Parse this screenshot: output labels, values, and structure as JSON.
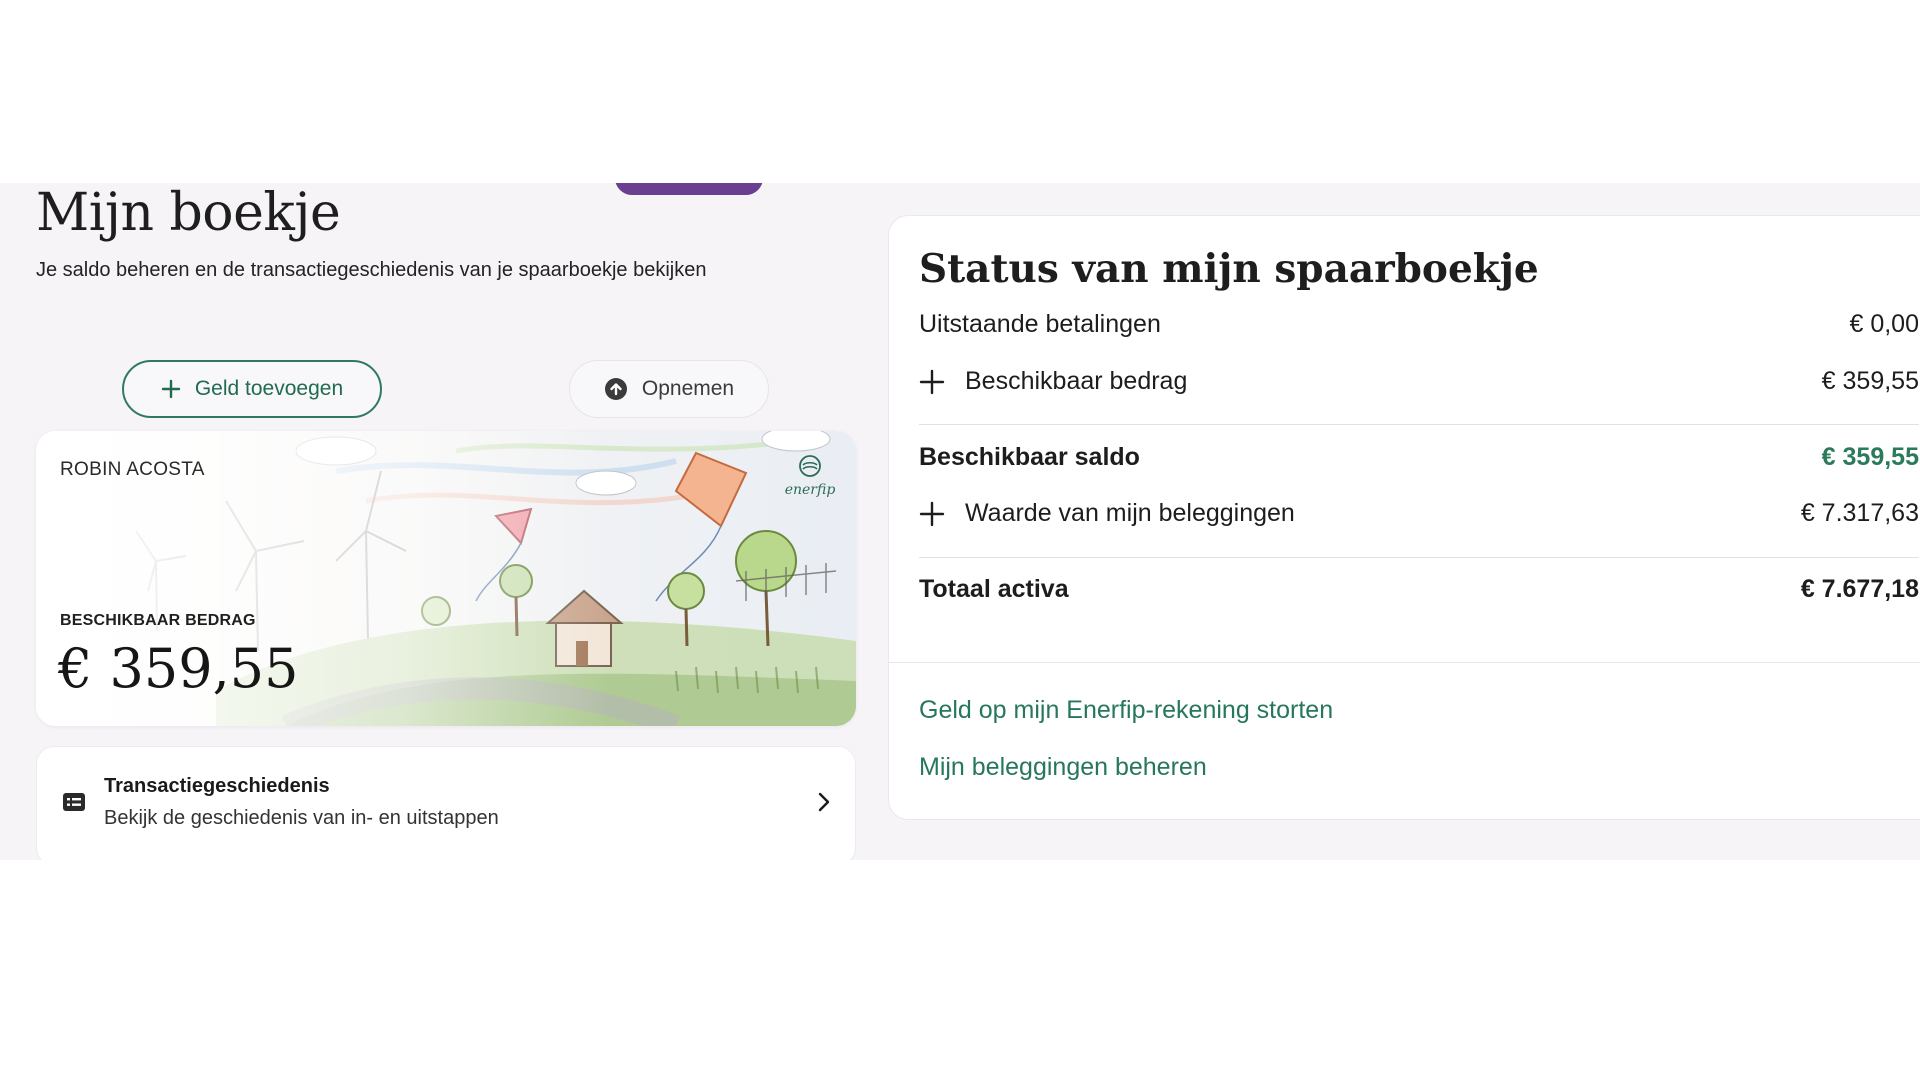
{
  "page": {
    "title": "Mijn boekje",
    "subtitle": "Je saldo beheren en de transactiegeschiedenis van je spaarboekje bekijken"
  },
  "actions": {
    "add_label": "Geld toevoegen",
    "withdraw_label": "Opnemen"
  },
  "card": {
    "owner": "ROBIN ACOSTA",
    "amount_label": "BESCHIKBAAR BEDRAG",
    "amount": "€ 359,55",
    "logo_text": "enerfip"
  },
  "history": {
    "title": "Transactiegeschiedenis",
    "description": "Bekijk de geschiedenis van in- en uitstappen"
  },
  "status": {
    "title": "Status van mijn spaarboekje",
    "rows": [
      {
        "label": "Uitstaande betalingen",
        "value": "€ 0,00"
      },
      {
        "label": "Beschikbaar bedrag",
        "value": "€ 359,55"
      },
      {
        "label": "Beschikbaar saldo",
        "value": "€ 359,55"
      },
      {
        "label": "Waarde van mijn beleggingen",
        "value": "€ 7.317,63"
      },
      {
        "label": "Totaal activa",
        "value": "€ 7.677,18"
      }
    ],
    "links": [
      {
        "label": "Geld op mijn Enerfip-rekening storten"
      },
      {
        "label": "Mijn beleggingen beheren"
      }
    ]
  },
  "colors": {
    "accent_green": "#2a7a5b",
    "brand_purple": "#6a3f8f",
    "background": "#f6f4f7"
  },
  "icons": [
    "plus-icon",
    "upload-circle-icon",
    "list-card-icon",
    "chevron-right-icon",
    "enerfip-logo-icon"
  ]
}
